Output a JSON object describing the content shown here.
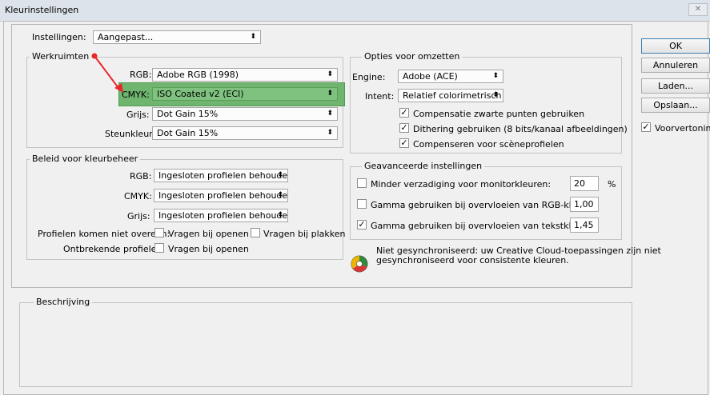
{
  "window": {
    "title": "Kleurinstellingen",
    "close": "✕"
  },
  "settings": {
    "label": "Instellingen:",
    "value": "Aangepast..."
  },
  "werkruimten": {
    "title": "Werkruimten",
    "rgb_label": "RGB:",
    "rgb_value": "Adobe RGB (1998)",
    "cmyk_label": "CMYK:",
    "cmyk_value": "ISO Coated v2 (ECI)",
    "grijs_label": "Grijs:",
    "grijs_value": "Dot Gain 15%",
    "steun_label": "Steunkleur:",
    "steun_value": "Dot Gain 15%"
  },
  "beleid": {
    "title": "Beleid voor kleurbeheer",
    "rgb_label": "RGB:",
    "rgb_value": "Ingesloten profielen behouden",
    "cmyk_label": "CMYK:",
    "cmyk_value": "Ingesloten profielen behouden",
    "grijs_label": "Grijs:",
    "grijs_value": "Ingesloten profielen behouden",
    "mismatch_label": "Profielen komen niet overeen:",
    "mismatch_open": "Vragen bij openen",
    "mismatch_paste": "Vragen bij plakken",
    "missing_label": "Ontbrekende profielen:",
    "missing_open": "Vragen bij openen"
  },
  "omzetten": {
    "title": "Opties voor omzetten",
    "engine_label": "Engine:",
    "engine_value": "Adobe (ACE)",
    "intent_label": "Intent:",
    "intent_value": "Relatief colorimetrisch",
    "bpc": "Compensatie zwarte punten gebruiken",
    "dither": "Dithering gebruiken (8 bits/kanaal afbeeldingen)",
    "scene": "Compenseren voor scèneprofielen"
  },
  "geavanceerd": {
    "title": "Geavanceerde instellingen",
    "desat": "Minder verzadiging voor monitorkleuren:",
    "desat_value": "20",
    "desat_unit": "%",
    "gamma_rgb": "Gamma gebruiken bij overvloeien van RGB-kleuren:",
    "gamma_rgb_value": "1,00",
    "gamma_text": "Gamma gebruiken bij overvloeien van tekstkleuren:",
    "gamma_text_value": "1,45"
  },
  "sync": {
    "text1": "Niet gesynchroniseerd: uw Creative Cloud-toepassingen zijn niet",
    "text2": "gesynchroniseerd voor consistente kleuren."
  },
  "beschrijving": {
    "title": "Beschrijving"
  },
  "buttons": {
    "ok": "OK",
    "cancel": "Annuleren",
    "load": "Laden...",
    "save": "Opslaan...",
    "preview": "Voorvertoning"
  },
  "check": "✓",
  "arrow": "⬍",
  "colors": {
    "highlight": "#6fb56f",
    "annotation": "#e8262b"
  }
}
